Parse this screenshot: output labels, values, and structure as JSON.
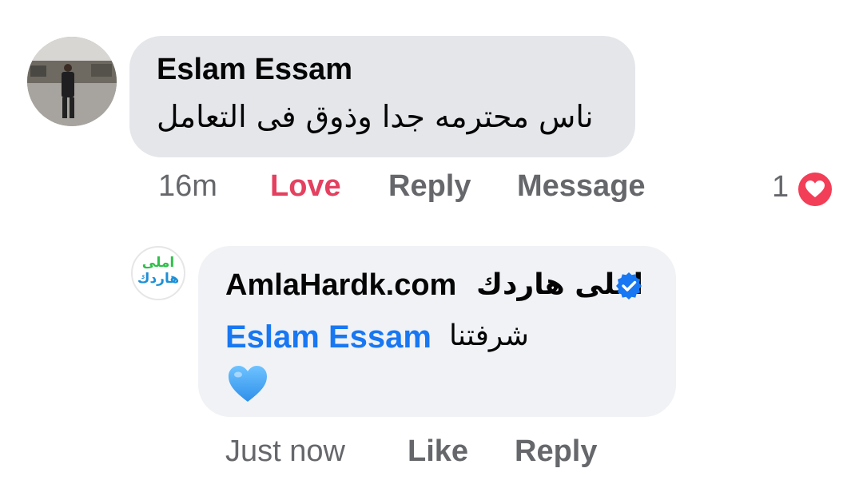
{
  "comment": {
    "author": "Eslam Essam",
    "text": "ناس محترمه جدا وذوق فى التعامل",
    "time": "16m",
    "actions": {
      "love": "Love",
      "reply": "Reply",
      "message": "Message"
    },
    "reaction": {
      "count": "1",
      "icon": "heart-icon",
      "color": "#f33e58"
    }
  },
  "reply": {
    "author_latin": "AmlaHardk.com",
    "author_arabic": "املى هاردك",
    "verified_icon": "verified-badge-icon",
    "avatar_logo": {
      "line1": "املى",
      "line2": "هاردك"
    },
    "mention": "Eslam Essam",
    "text": "شرفتنا",
    "emoji": "blue-heart-icon",
    "time": "Just now",
    "actions": {
      "like": "Like",
      "reply": "Reply"
    }
  },
  "colors": {
    "love": "#e4405f",
    "mention": "#1877f2",
    "verified": "#1877f2",
    "muted_text": "#65676b"
  }
}
